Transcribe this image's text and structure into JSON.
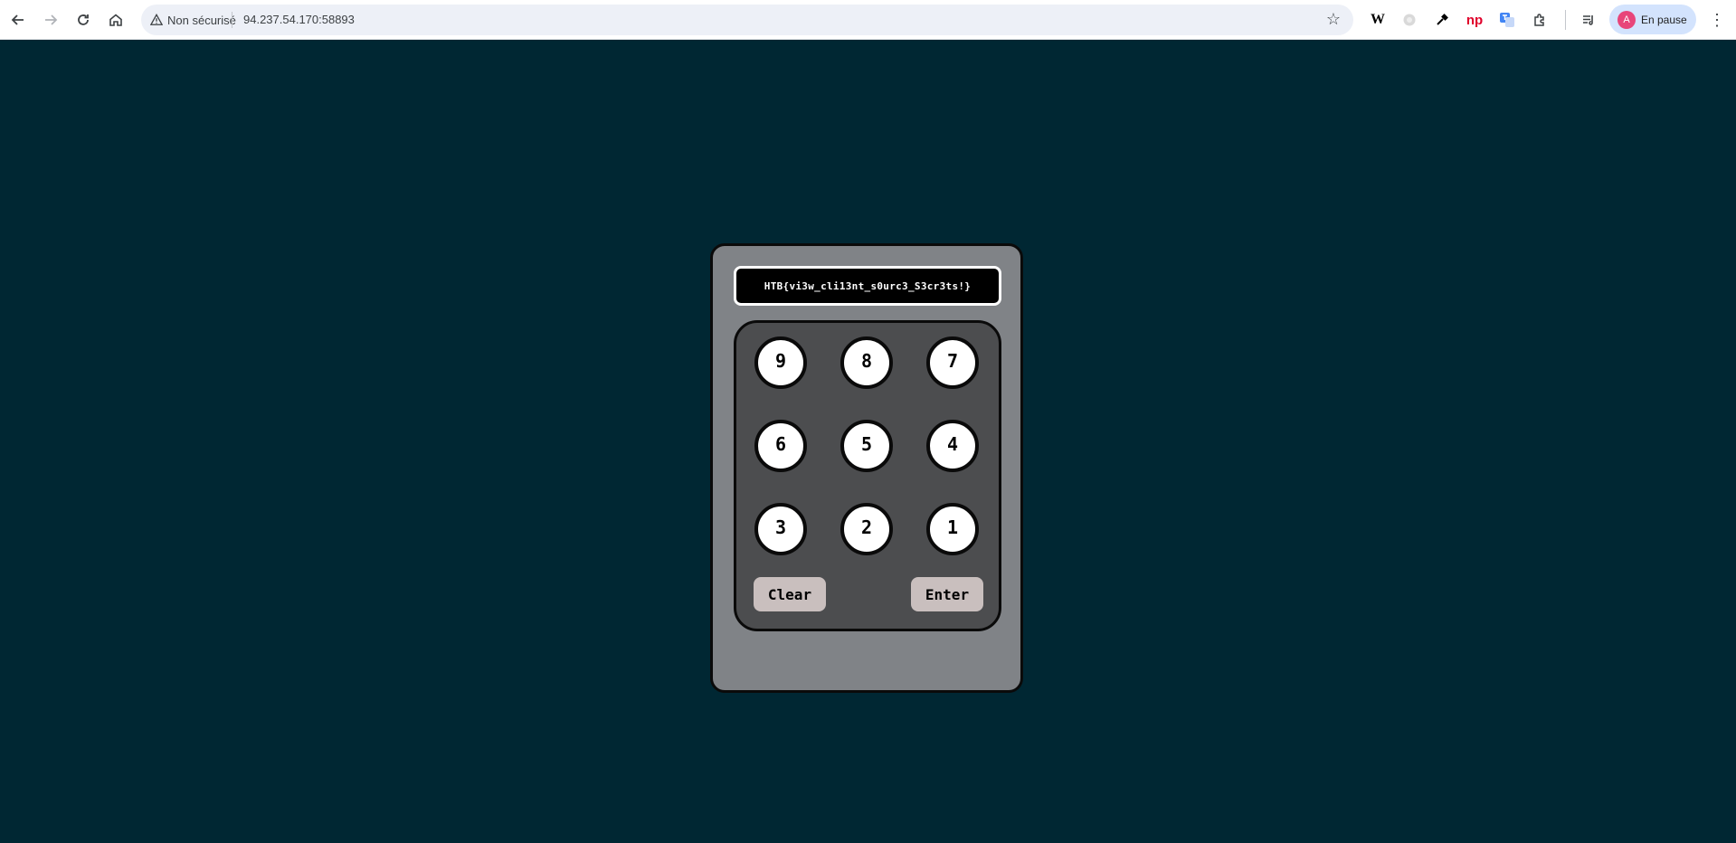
{
  "browser": {
    "security_label": "Non sécurisé",
    "url": "94.237.54.170:58893",
    "profile_initial": "A",
    "profile_status": "En pause",
    "extensions": [
      "wikipedia-extension-icon",
      "grayed-extension-icon",
      "color-picker-icon",
      "np-extension-icon",
      "translate-icon",
      "puzzle-icon"
    ],
    "extension_labels": {
      "wikipedia": "W",
      "np": "np"
    }
  },
  "display": {
    "text": "HTB{vi3w_cli13nt_s0urc3_S3cr3ts!}"
  },
  "keypad": {
    "keys": [
      "9",
      "8",
      "7",
      "6",
      "5",
      "4",
      "3",
      "2",
      "1"
    ],
    "clear_label": "Clear",
    "enter_label": "Enter"
  },
  "colors": {
    "page_background": "#002733",
    "device_body": "#808387",
    "pad_background": "#4c4d4f",
    "action_button": "#c9bfbe"
  }
}
